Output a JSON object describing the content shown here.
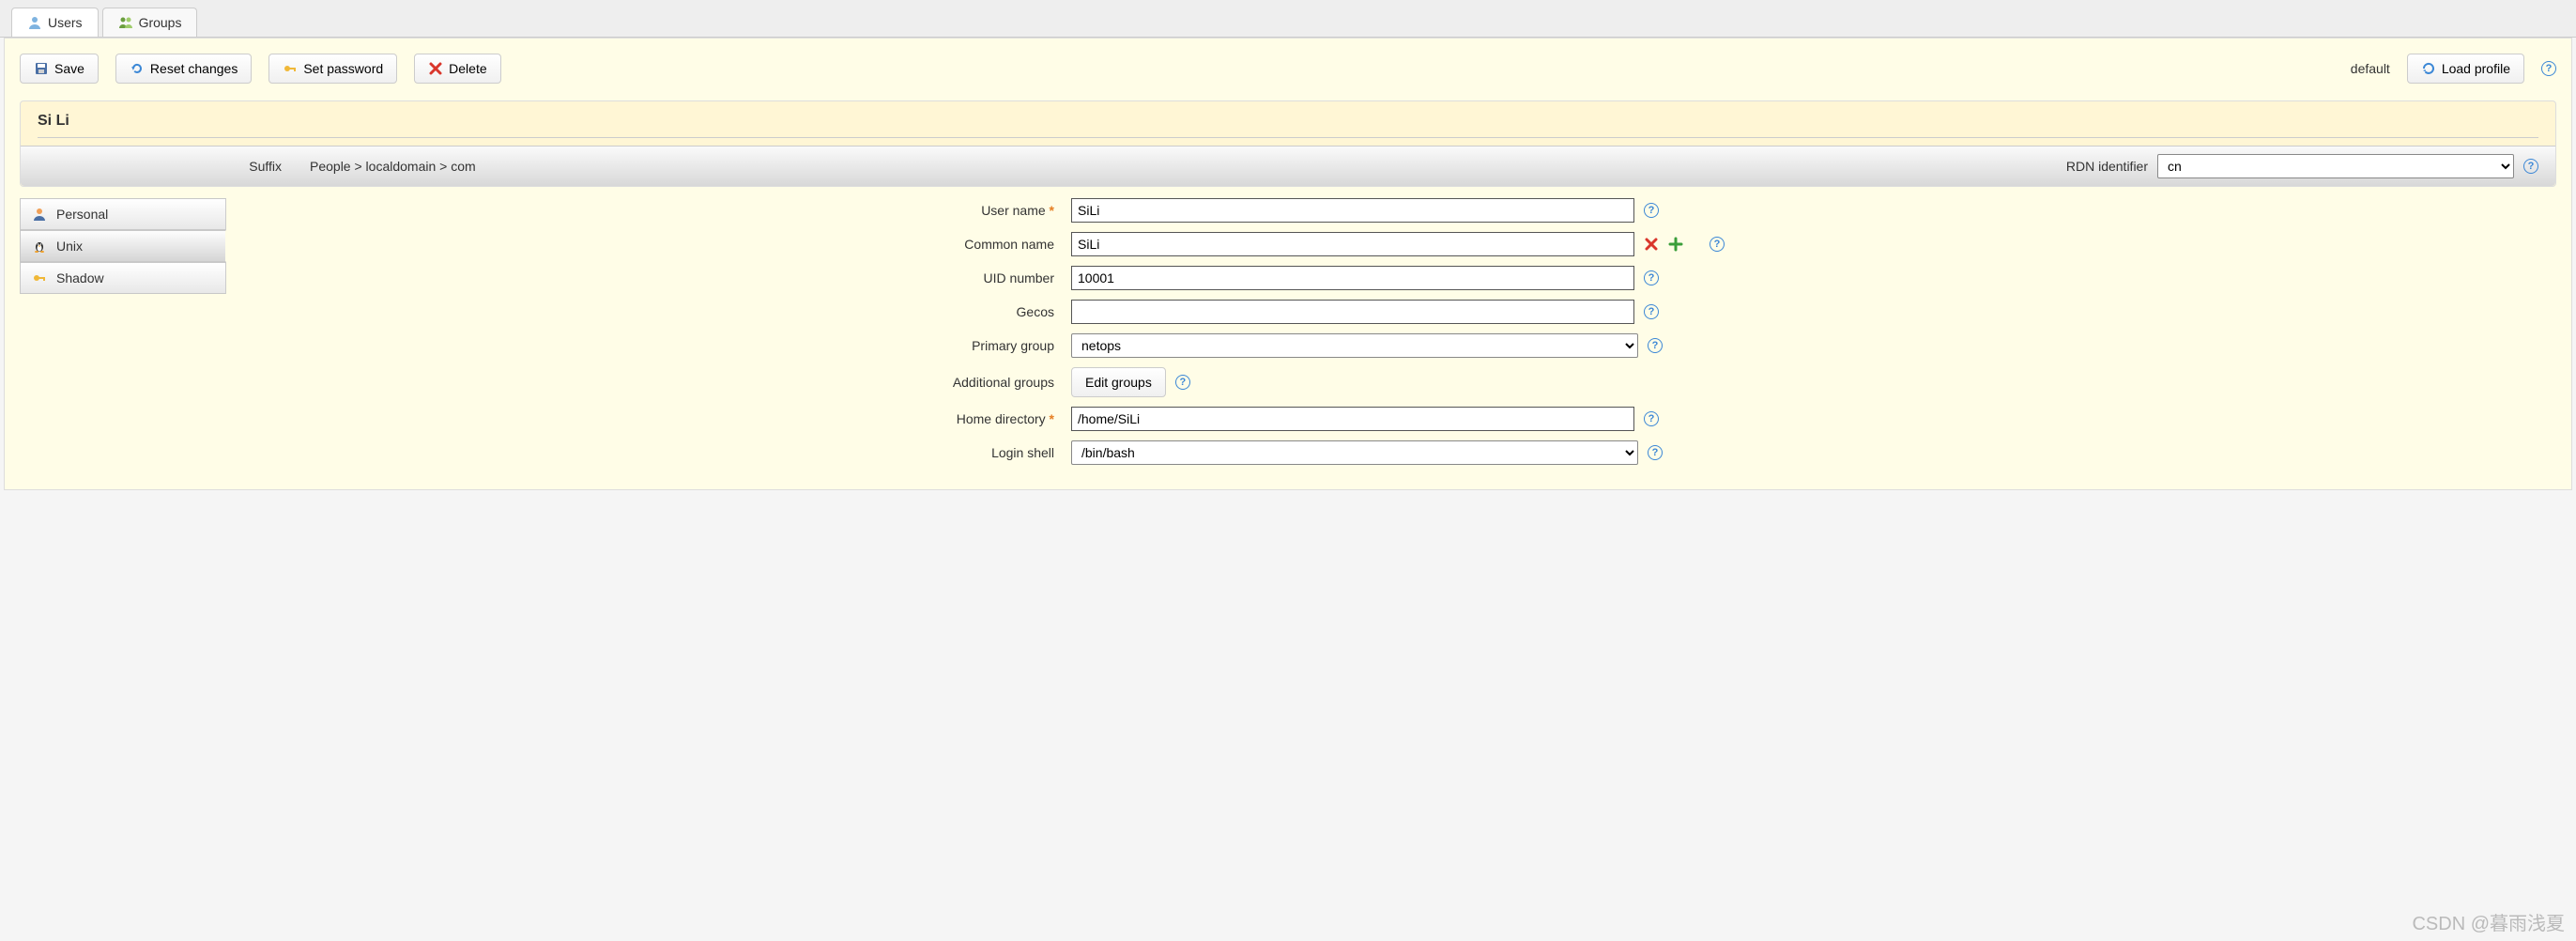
{
  "tabs": {
    "users": "Users",
    "groups": "Groups"
  },
  "toolbar": {
    "save": "Save",
    "reset": "Reset changes",
    "setpwd": "Set password",
    "delete": "Delete",
    "default": "default",
    "loadprofile": "Load profile"
  },
  "header": {
    "title": "Si Li",
    "suffix_label": "Suffix",
    "suffix_path": "People > localdomain > com",
    "rdn_label": "RDN identifier",
    "rdn_value": "cn"
  },
  "sidebar": {
    "personal": "Personal",
    "unix": "Unix",
    "shadow": "Shadow"
  },
  "form": {
    "username_label": "User name",
    "username_value": "SiLi",
    "commonname_label": "Common name",
    "commonname_value": "SiLi",
    "uid_label": "UID number",
    "uid_value": "10001",
    "gecos_label": "Gecos",
    "gecos_value": "",
    "primarygroup_label": "Primary group",
    "primarygroup_value": "netops",
    "addgroups_label": "Additional groups",
    "editgroups_btn": "Edit groups",
    "homedir_label": "Home directory",
    "homedir_value": "/home/SiLi",
    "loginshell_label": "Login shell",
    "loginshell_value": "/bin/bash"
  },
  "watermark": "CSDN @暮雨浅夏"
}
